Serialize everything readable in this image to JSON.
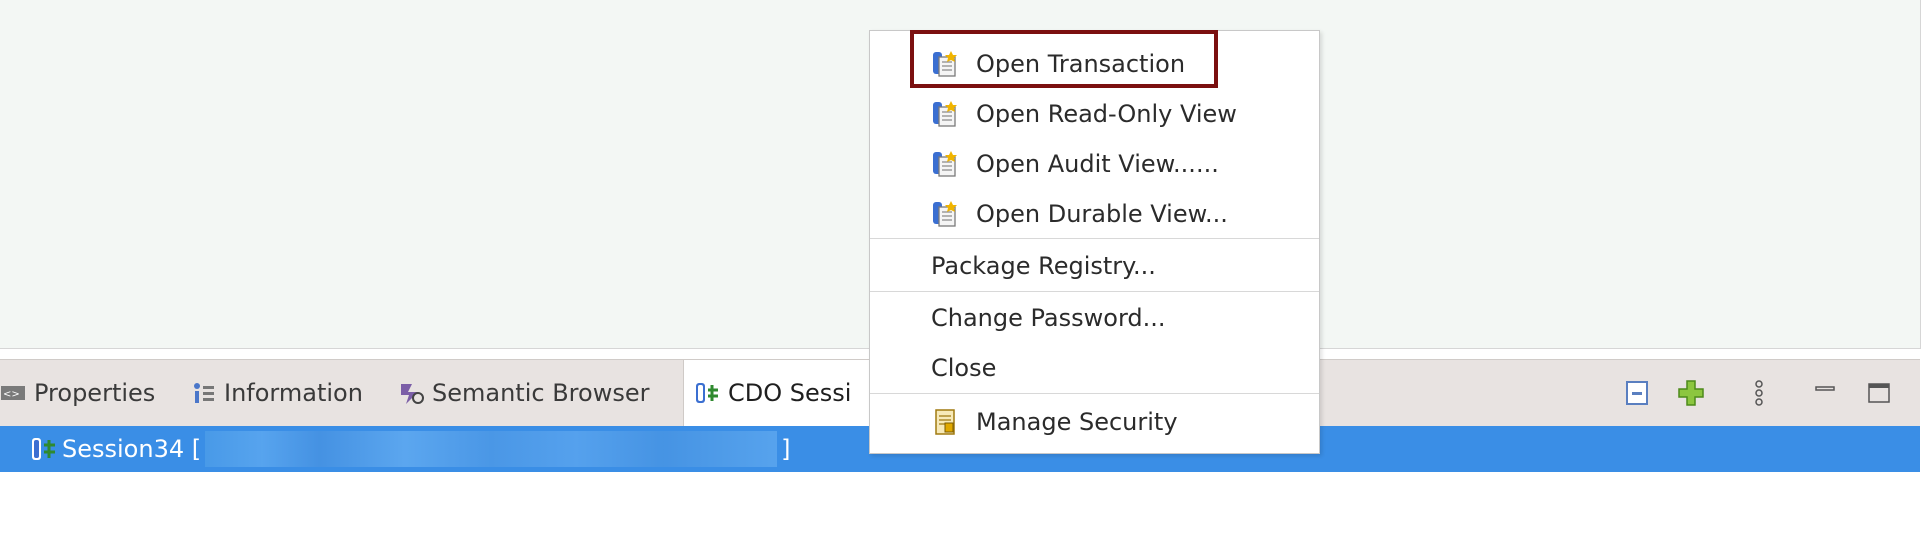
{
  "tabs": [
    {
      "label": "Properties",
      "icon": "properties-icon"
    },
    {
      "label": "Information",
      "icon": "information-icon"
    },
    {
      "label": "Semantic Browser",
      "icon": "semantic-browser-icon"
    },
    {
      "label": "CDO Sessi",
      "icon": "cdo-session-icon"
    }
  ],
  "session_row": {
    "label": "Session34 [",
    "suffix": "]"
  },
  "context_menu": {
    "items": [
      {
        "label": "Open Transaction",
        "icon": "transaction-icon"
      },
      {
        "label": "Open Read-Only View",
        "icon": "transaction-icon"
      },
      {
        "label": "Open Audit View......",
        "icon": "transaction-icon"
      },
      {
        "label": "Open Durable View...",
        "icon": "transaction-icon"
      },
      {
        "label": "Package Registry..."
      },
      {
        "label": "Change Password..."
      },
      {
        "label": "Close"
      },
      {
        "label": "Manage Security",
        "icon": "security-icon"
      }
    ]
  },
  "colors": {
    "selection": "#3a8ee6",
    "highlight_border": "#7b1010",
    "editor_bg": "#f3f7f4",
    "tabbar_bg": "#e8e3e1"
  }
}
